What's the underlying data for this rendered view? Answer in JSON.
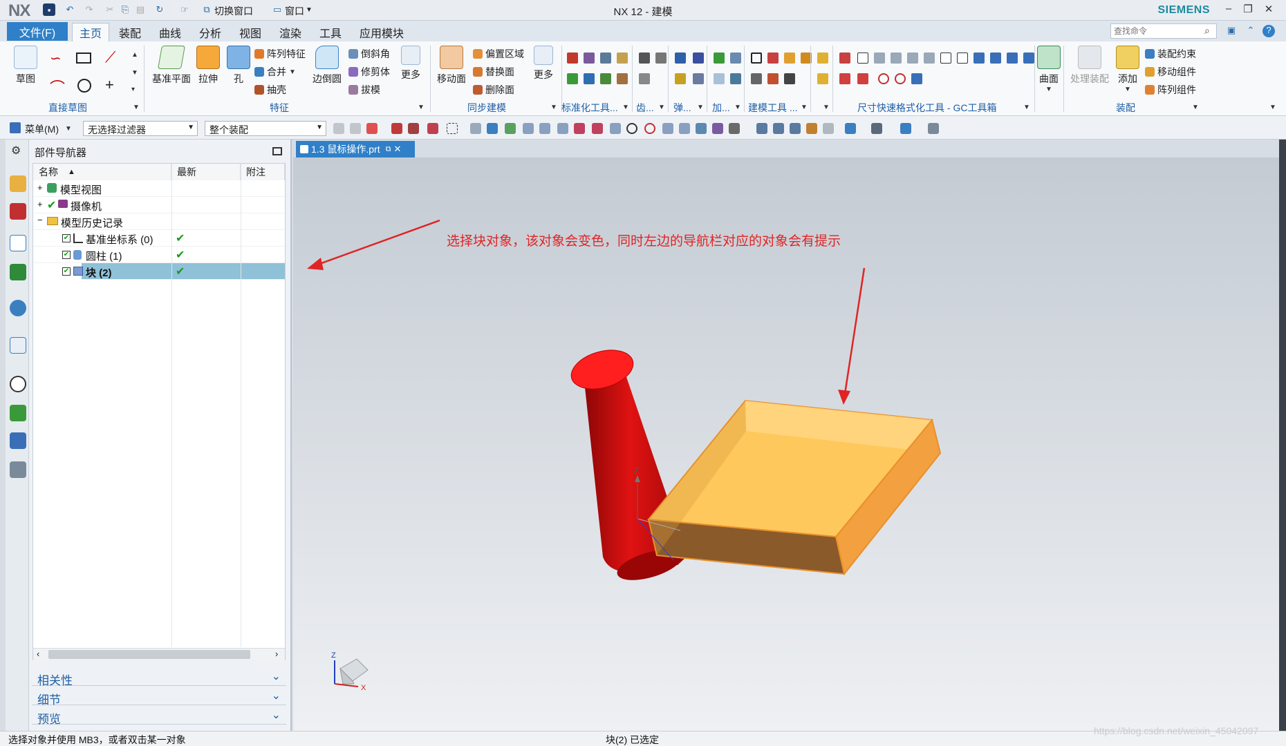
{
  "app": {
    "logo": "NX",
    "window_title": "NX 12 - 建模",
    "brand": "SIEMENS"
  },
  "quick_access": {
    "switch_window": "切换窗口",
    "window": "窗口"
  },
  "menu_tabs": [
    "主页",
    "装配",
    "曲线",
    "分析",
    "视图",
    "渲染",
    "工具",
    "应用模块"
  ],
  "file_tab": "文件(F)",
  "search": {
    "placeholder": "查找命令"
  },
  "ribbon": {
    "sketch": {
      "big": "草图",
      "group": "直接草图"
    },
    "feature": {
      "datum_plane": "基准平面",
      "extrude": "拉伸",
      "hole": "孔",
      "pattern": "阵列特征",
      "unite": "合并",
      "shell": "抽壳",
      "edge_blend": "边倒圆",
      "chamfer": "倒斜角",
      "trim_body": "修剪体",
      "draft": "拔模",
      "more": "更多",
      "group": "特征"
    },
    "sync": {
      "move_face": "移动面",
      "offset_region": "偏置区域",
      "replace_face": "替换面",
      "delete_face": "删除面",
      "more": "更多",
      "group": "同步建模"
    },
    "group_std": "标准化工具...",
    "group_gear": "齿...",
    "group_spring": "弹...",
    "group_add": "加...",
    "group_modeling": "建模工具 ...",
    "group_dim": "尺寸快速格式化工具 - GC工具箱",
    "surface": "曲面",
    "asm": {
      "process": "处理装配",
      "add": "添加",
      "constraint": "装配约束",
      "move_comp": "移动组件",
      "array_comp": "阵列组件",
      "group": "装配"
    }
  },
  "toolbar2": {
    "menu": "菜单(M)",
    "filter": "无选择过滤器",
    "scope": "整个装配"
  },
  "navigator": {
    "title": "部件导航器",
    "columns": [
      "名称",
      "最新",
      "附注"
    ],
    "rows": [
      {
        "label": "模型视图",
        "expand": "+"
      },
      {
        "label": "摄像机",
        "expand": "+"
      },
      {
        "label": "模型历史记录",
        "expand": "−"
      },
      {
        "label": "基准坐标系 (0)"
      },
      {
        "label": "圆柱 (1)"
      },
      {
        "label": "块 (2)"
      }
    ],
    "sections": [
      "相关性",
      "细节",
      "预览"
    ]
  },
  "viewport": {
    "tab": "1.3 鼠标操作.prt",
    "annotation": "选择块对象，该对象会变色，同时左边的导航栏对应的对象会有提示",
    "axis_z": "Z",
    "axis_x": "X"
  },
  "status": {
    "left": "选择对象并使用 MB3，或者双击某一对象",
    "mid": "块(2) 已选定"
  },
  "watermark": "https://blog.csdn.net/weixin_45042097",
  "colors": {
    "accent": "#2f80c8",
    "block": "#ffc85c",
    "cylinder": "#d40f0f",
    "annotation": "#e02424"
  }
}
